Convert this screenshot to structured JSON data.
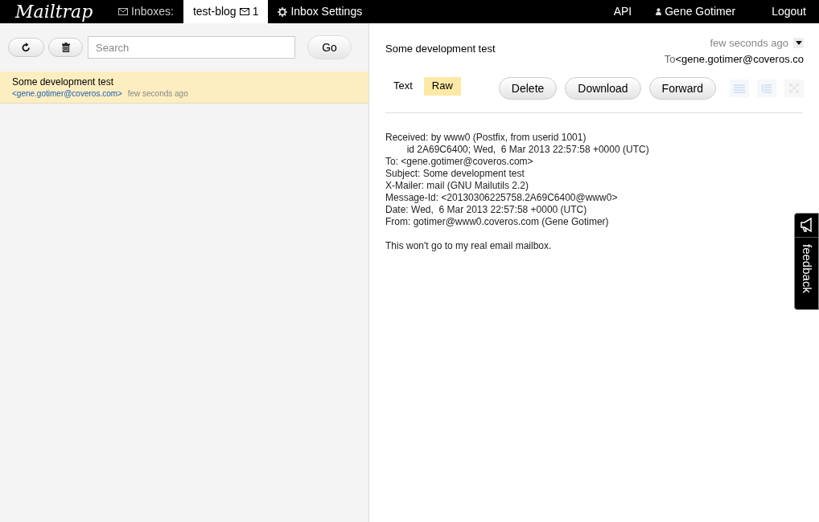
{
  "nav": {
    "logo": "Mailtrap",
    "inboxes_label": "Inboxes:",
    "inbox_tab": {
      "label": "test-blog",
      "count": "1",
      "selected": true
    },
    "settings": "Inbox Settings",
    "api": "API",
    "user": "Gene Gotimer",
    "logout": "Logout"
  },
  "toolbar": {
    "search": {
      "placeholder": "Search"
    },
    "go": "Go"
  },
  "messages": [
    {
      "subject": "Some development test",
      "from": "<gene.gotimer@coveros.com>",
      "time": "few seconds ago",
      "selected": true
    }
  ],
  "message": {
    "subject": "Some development test",
    "time": "few seconds ago",
    "to_label": "To",
    "to": "<gene.gotimer@coveros.co",
    "views": [
      {
        "label": "Text",
        "selected": false
      },
      {
        "label": "Raw",
        "selected": true
      }
    ],
    "actions": [
      "Delete",
      "Download",
      "Forward"
    ],
    "raw_lines": [
      "Received: by www0 (Postfix, from userid 1001)",
      "        id 2A69C6400; Wed,  6 Mar 2013 22:57:58 +0000 (UTC)",
      "To: <gene.gotimer@coveros.com>",
      "Subject: Some development test",
      "X-Mailer: mail (GNU Mailutils 2.2)",
      "Message-Id: <20130306225758.2A69C6400@www0>",
      "Date: Wed,  6 Mar 2013 22:57:58 +0000 (UTC)",
      "From: gotimer@www0.coveros.com (Gene Gotimer)"
    ],
    "body": "This won't go to my real email mailbox."
  },
  "feedback": "feedback"
}
